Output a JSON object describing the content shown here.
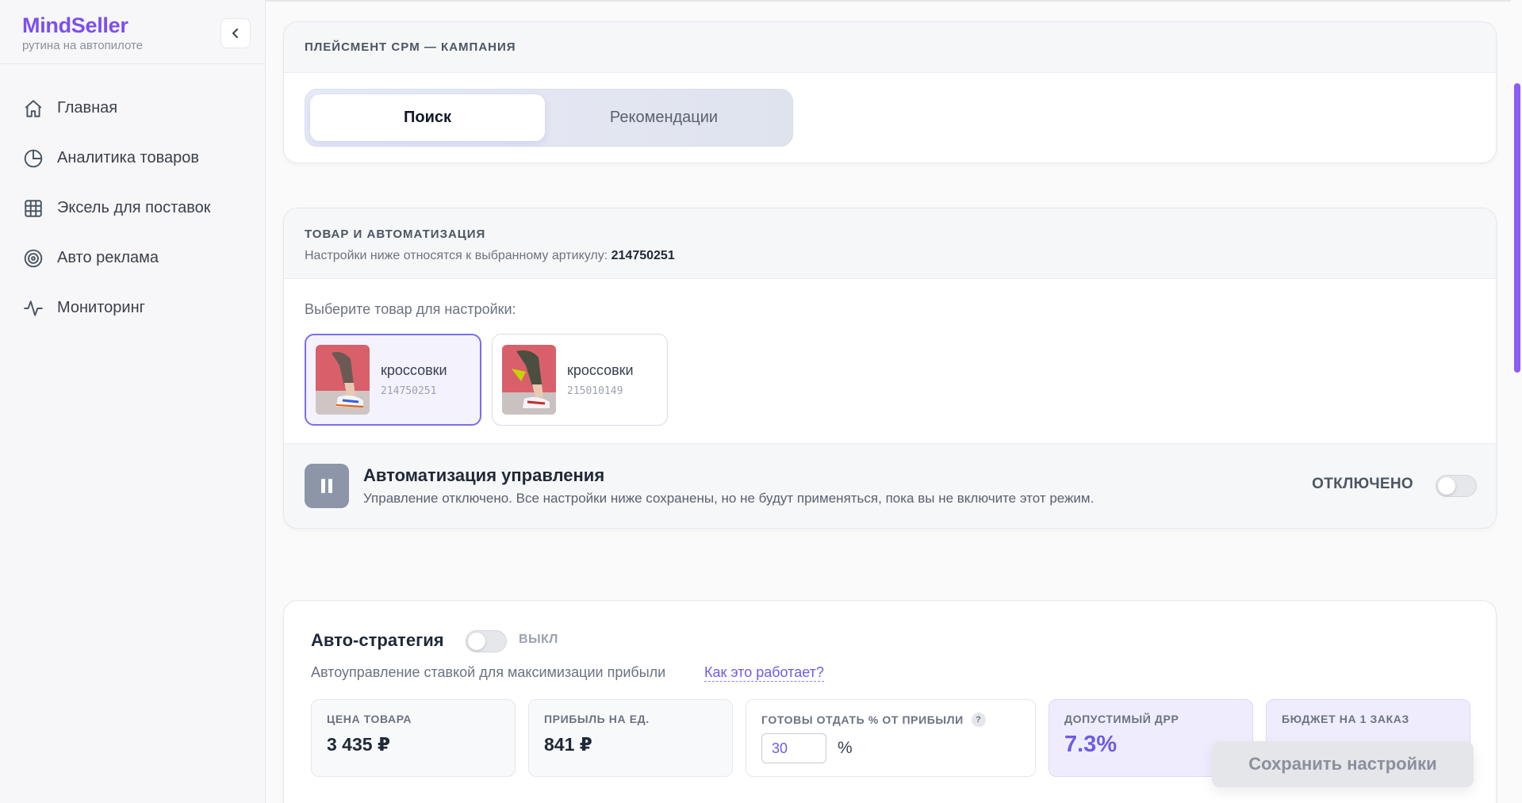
{
  "brand": {
    "name": "MindSeller",
    "tagline": "рутина на автопилоте"
  },
  "sidebar": {
    "items": [
      {
        "label": "Главная",
        "icon": "home-icon"
      },
      {
        "label": "Аналитика товаров",
        "icon": "pie-chart-icon"
      },
      {
        "label": "Эксель для поставок",
        "icon": "grid-icon"
      },
      {
        "label": "Авто реклама",
        "icon": "target-icon"
      },
      {
        "label": "Мониторинг",
        "icon": "pulse-icon"
      }
    ]
  },
  "placement": {
    "title": "ПЛЕЙСМЕНТ CPM — КАМПАНИЯ",
    "tabs": [
      {
        "label": "Поиск",
        "active": true
      },
      {
        "label": "Рекомендации",
        "active": false
      }
    ]
  },
  "product_section": {
    "title": "ТОВАР И АВТОМАТИЗАЦИЯ",
    "note_prefix": "Настройки ниже относятся к выбранному артикулу:",
    "note_sku": "214750251",
    "choose_label": "Выберите товар для настройки:",
    "products": [
      {
        "name": "кроссовки",
        "sku": "214750251",
        "selected": true
      },
      {
        "name": "кроссовки",
        "sku": "215010149",
        "selected": false
      }
    ],
    "automation": {
      "title": "Автоматизация управления",
      "description": "Управление отключено. Все настройки ниже сохранены, но не будут применяться, пока вы не включите этот режим.",
      "state": "ОТКЛЮЧЕНО",
      "enabled": false
    }
  },
  "auto_strategy": {
    "title": "Авто-стратегия",
    "state": "ВЫКЛ",
    "enabled": false,
    "description": "Автоуправление ставкой для максимизации прибыли",
    "link": "Как это работает?",
    "metrics": {
      "price": {
        "label": "ЦЕНА ТОВАРА",
        "value": "3 435 ₽"
      },
      "profit": {
        "label": "ПРИБЫЛЬ НА ЕД.",
        "value": "841 ₽"
      },
      "share": {
        "label": "ГОТОВЫ ОТДАТЬ % ОТ ПРИБЫЛИ",
        "help": "?",
        "input_value": "30",
        "unit": "%"
      },
      "drr": {
        "label": "ДОПУСТИМЫЙ ДРР",
        "value": "7.3%"
      },
      "budget": {
        "label": "БЮДЖЕТ НА 1 ЗАКАЗ"
      }
    }
  },
  "save_button": "Сохранить настройки",
  "colors": {
    "accent": "#7c4ff0",
    "link": "#6d5ce8",
    "selected_border": "#7b6df0"
  }
}
